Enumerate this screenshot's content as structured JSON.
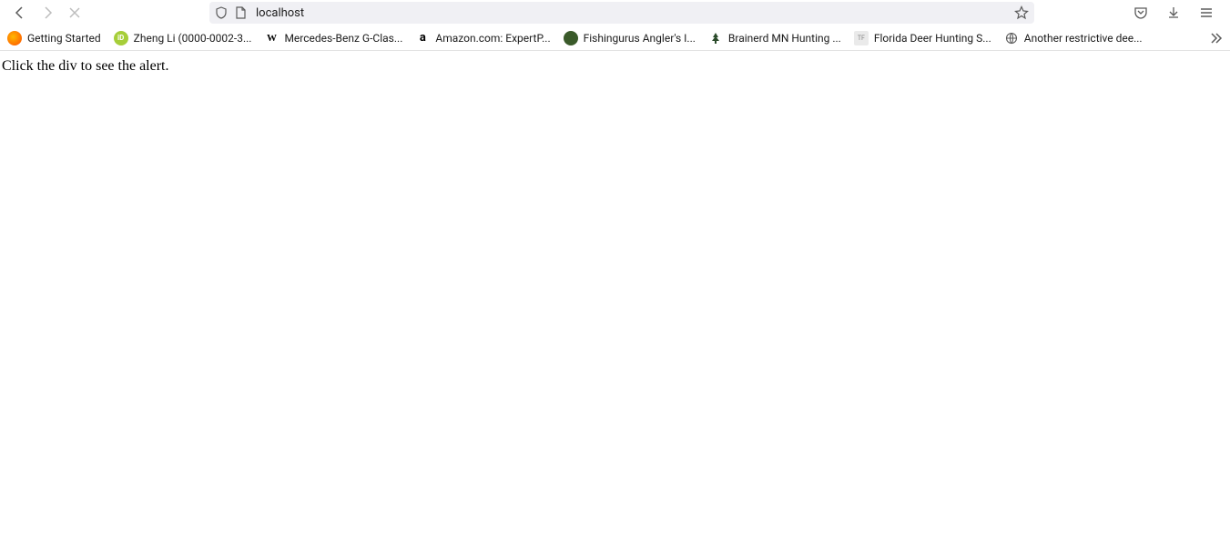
{
  "url": "localhost",
  "bookmarks": [
    {
      "label": "Getting Started",
      "icon_bg": "linear-gradient(135deg,#ff9500,#ff4e00)",
      "icon_text": ""
    },
    {
      "label": "Zheng Li (0000-0002-3...",
      "icon_bg": "#a6ce39",
      "icon_text": "iD"
    },
    {
      "label": "Mercedes-Benz G-Clas...",
      "icon_bg": "#fff",
      "icon_text": "W"
    },
    {
      "label": "Amazon.com: ExpertP...",
      "icon_bg": "#fff",
      "icon_text": "a"
    },
    {
      "label": "Fishingurus Angler's I...",
      "icon_bg": "#3a5a2a",
      "icon_text": ""
    },
    {
      "label": "Brainerd MN Hunting ...",
      "icon_bg": "#fff",
      "icon_text": ""
    },
    {
      "label": "Florida Deer Hunting S...",
      "icon_bg": "#eaeaea",
      "icon_text": ""
    },
    {
      "label": "Another restrictive dee...",
      "icon_bg": "#fff",
      "icon_text": ""
    }
  ],
  "page": {
    "body_text": "Click the div to see the alert."
  }
}
